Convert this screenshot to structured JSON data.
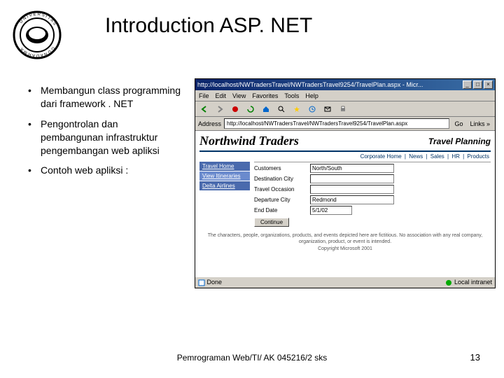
{
  "title": "Introduction ASP. NET",
  "logo_alt": "Universitas Gunadarma",
  "bullets": [
    "Membangun class programming dari framework . NET",
    "Pengontrolan dan pembangunan infrastruktur pengembangan web apliksi",
    "Contoh web apliksi :"
  ],
  "browser": {
    "titlebar": "http://localhost/NWTradersTravel/NWTradersTravel9254/TravelPlan.aspx - Micr...",
    "win_min": "_",
    "win_max": "□",
    "win_close": "×",
    "menu": [
      "File",
      "Edit",
      "View",
      "Favorites",
      "Tools",
      "Help"
    ],
    "address_label": "Address",
    "address_value": "http://localhost/NWTradersTravel/NWTradersTravel9254/TravelPlan.aspx",
    "go": "Go",
    "links": "Links »",
    "status_left": "Done",
    "status_right": "Local intranet"
  },
  "page": {
    "brand": "Northwind Traders",
    "heading": "Travel Planning",
    "nav": [
      "Corporate Home",
      "News",
      "Sales",
      "HR",
      "Products"
    ],
    "sidebar": [
      "Travel Home",
      "View Itineraries",
      "Delta Airlines"
    ],
    "form": {
      "customer_label": "Customers",
      "customer_value": "North/South",
      "dest_label": "Destination City",
      "dest_value": "",
      "occasion_label": "Travel Occasion",
      "occasion_value": "",
      "depart_label": "Departure City",
      "depart_value": "Redmond",
      "end_label": "End Date",
      "end_value": "5/1/02",
      "continue": "Continue"
    },
    "disclaimer": "The characters, people, organizations, products, and events depicted here are fictitious. No association with any real company, organization, product, or event is intended.",
    "copyright": "Copyright Microsoft 2001"
  },
  "footer": "Pemrograman Web/TI/ AK 045216/2 sks",
  "page_number": "13"
}
